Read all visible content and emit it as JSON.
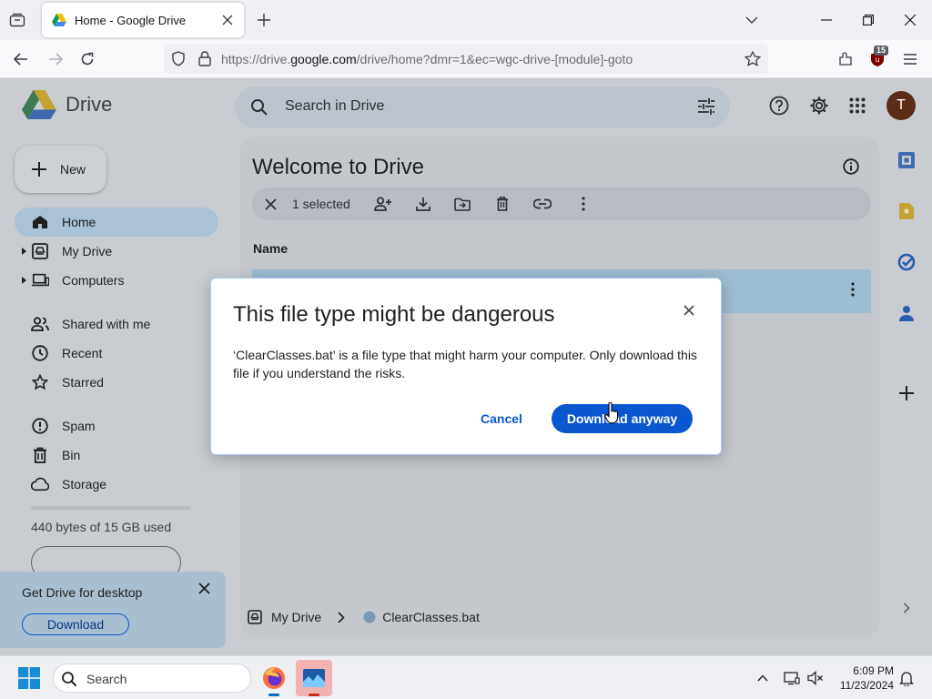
{
  "browser": {
    "tab_title": "Home - Google Drive",
    "url_prefix": "https://drive.",
    "url_domain": "google.com",
    "url_path": "/drive/home?dmr=1&ec=wgc-drive-[module]-goto",
    "extension_badge": "15"
  },
  "drive": {
    "logo_text": "Drive",
    "search_placeholder": "Search in Drive",
    "avatar_letter": "T",
    "new_label": "New",
    "nav": [
      {
        "label": "Home",
        "icon": "home-icon"
      },
      {
        "label": "My Drive",
        "icon": "my-drive-icon"
      },
      {
        "label": "Computers",
        "icon": "computers-icon"
      },
      {
        "label": "Shared with me",
        "icon": "shared-icon"
      },
      {
        "label": "Recent",
        "icon": "clock-icon"
      },
      {
        "label": "Starred",
        "icon": "star-icon"
      },
      {
        "label": "Spam",
        "icon": "spam-icon"
      },
      {
        "label": "Bin",
        "icon": "bin-icon"
      },
      {
        "label": "Storage",
        "icon": "cloud-icon"
      }
    ],
    "storage_text": "440 bytes of 15 GB used",
    "storage_used_fraction": 0.0,
    "promo": {
      "title": "Get Drive for desktop",
      "button": "Download"
    },
    "welcome_title": "Welcome to Drive",
    "selected_text": "1 selected",
    "column_name": "Name",
    "breadcrumb": {
      "root": "My Drive",
      "file": "ClearClasses.bat"
    }
  },
  "dialog": {
    "title": "This file type might be dangerous",
    "body": "‘ClearClasses.bat’ is a file type that might harm your computer. Only download this file if you understand the risks.",
    "cancel": "Cancel",
    "confirm": "Download anyway"
  },
  "taskbar": {
    "search_label": "Search",
    "time": "6:09 PM",
    "date": "11/23/2024"
  },
  "colors": {
    "accent": "#0b57d0",
    "selected_row": "#9ebcd2",
    "overlay_bg": "#c9cdd2"
  }
}
